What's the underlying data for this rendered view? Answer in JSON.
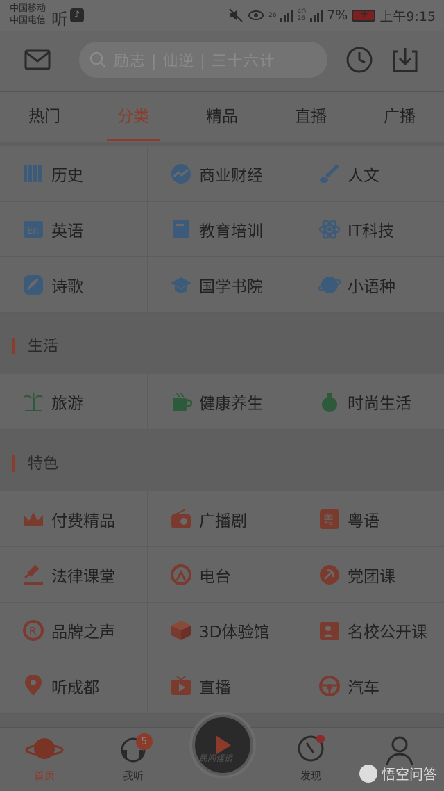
{
  "status_bar": {
    "carrier1": "中国移动",
    "carrier2": "中国电信",
    "app_glyph": "听",
    "signal1": "26",
    "signal2a": "4G",
    "signal2b": "26",
    "battery": "7%",
    "time": "上午9:15"
  },
  "header": {
    "search_placeholder": "励志 | 仙逆 | 三十六计"
  },
  "tabs": [
    "热门",
    "分类",
    "精品",
    "直播",
    "广播"
  ],
  "active_tab": 1,
  "categories_main": [
    {
      "label": "历史",
      "icon": "books-icon",
      "color": "#3c5a7a"
    },
    {
      "label": "商业财经",
      "icon": "chart-icon",
      "color": "#3c5a7a"
    },
    {
      "label": "人文",
      "icon": "brush-icon",
      "color": "#3c5a7a"
    },
    {
      "label": "英语",
      "icon": "english-icon",
      "color": "#3c5a7a"
    },
    {
      "label": "教育培训",
      "icon": "book-icon",
      "color": "#3c5a7a"
    },
    {
      "label": "IT科技",
      "icon": "atom-icon",
      "color": "#3c5a7a"
    },
    {
      "label": "诗歌",
      "icon": "quill-icon",
      "color": "#3c5a7a"
    },
    {
      "label": "国学书院",
      "icon": "graduation-cap-icon",
      "color": "#3c5a7a"
    },
    {
      "label": "小语种",
      "icon": "globe-icon",
      "color": "#3c5a7a"
    }
  ],
  "section_life": {
    "title": "生活",
    "items": [
      {
        "label": "旅游",
        "icon": "palm-tree-icon",
        "color": "#2e5a3c"
      },
      {
        "label": "健康养生",
        "icon": "tea-cup-icon",
        "color": "#2e5a3c"
      },
      {
        "label": "时尚生活",
        "icon": "perfume-icon",
        "color": "#2e5a3c"
      }
    ]
  },
  "section_special": {
    "title": "特色",
    "items": [
      {
        "label": "付费精品",
        "icon": "crown-icon",
        "color": "#7a3a2e"
      },
      {
        "label": "广播剧",
        "icon": "radio-icon",
        "color": "#7a3a2e"
      },
      {
        "label": "粤语",
        "icon": "cantonese-icon",
        "color": "#7a3a2e"
      },
      {
        "label": "法律课堂",
        "icon": "gavel-icon",
        "color": "#7a3a2e"
      },
      {
        "label": "电台",
        "icon": "broadcast-icon",
        "color": "#7a3a2e"
      },
      {
        "label": "党团课",
        "icon": "party-emblem-icon",
        "color": "#7a3a2e"
      },
      {
        "label": "品牌之声",
        "icon": "registered-icon",
        "color": "#7a3a2e"
      },
      {
        "label": "3D体验馆",
        "icon": "cube-icon",
        "color": "#7a3a2e"
      },
      {
        "label": "名校公开课",
        "icon": "school-icon",
        "color": "#7a3a2e"
      },
      {
        "label": "听成都",
        "icon": "location-pin-icon",
        "color": "#7a3a2e"
      },
      {
        "label": "直播",
        "icon": "tv-play-icon",
        "color": "#7a3a2e"
      },
      {
        "label": "汽车",
        "icon": "steering-wheel-icon",
        "color": "#7a3a2e"
      }
    ]
  },
  "bottom_nav": {
    "home": "首页",
    "listen": "我听",
    "listen_badge": "5",
    "discover": "发现",
    "center_text": "民间怪谈"
  },
  "watermark": "悟空问答"
}
